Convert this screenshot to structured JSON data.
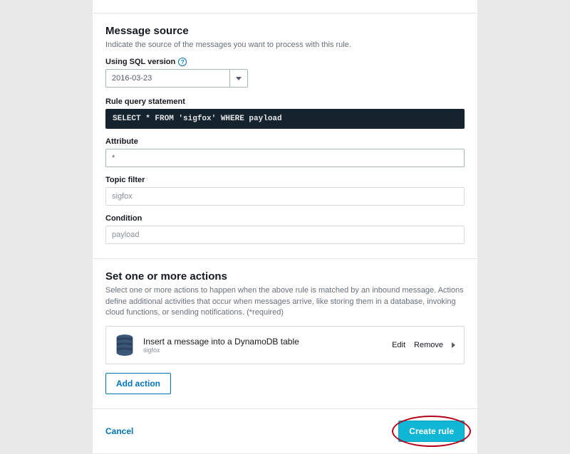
{
  "messageSource": {
    "title": "Message source",
    "desc": "Indicate the source of the messages you want to process with this rule.",
    "sqlVersionLabel": "Using SQL version",
    "sqlVersionValue": "2016-03-23",
    "ruleQueryLabel": "Rule query statement",
    "ruleQuery": "SELECT * FROM 'sigfox' WHERE payload",
    "attributeLabel": "Attribute",
    "attributeValue": "*",
    "topicFilterLabel": "Topic filter",
    "topicFilterValue": "sigfox",
    "conditionLabel": "Condition",
    "conditionValue": "payload"
  },
  "actions": {
    "title": "Set one or more actions",
    "desc": "Select one or more actions to happen when the above rule is matched by an inbound message. Actions define additional activities that occur when messages arrive, like storing them in a database, invoking cloud functions, or sending notifications. (*required)",
    "item": {
      "title": "Insert a message into a DynamoDB table",
      "sub": "sigfox",
      "editLabel": "Edit",
      "removeLabel": "Remove"
    },
    "addActionLabel": "Add action"
  },
  "footer": {
    "cancelLabel": "Cancel",
    "createLabel": "Create rule"
  }
}
